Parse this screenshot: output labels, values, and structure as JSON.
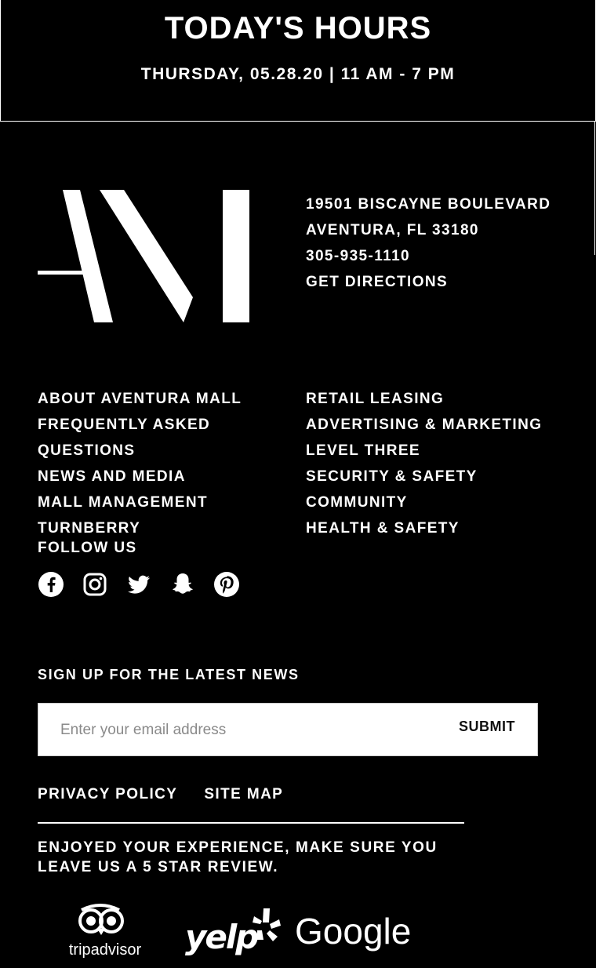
{
  "hours": {
    "title": "TODAY'S HOURS",
    "line": "THURSDAY, 05.28.20 | 11 AM - 7 PM"
  },
  "address": {
    "street": "19501 BISCAYNE BOULEVARD",
    "city": "AVENTURA, FL 33180",
    "phone": "305-935-1110",
    "directions": "GET DIRECTIONS"
  },
  "links_left": [
    "ABOUT AVENTURA MALL",
    "FREQUENTLY ASKED",
    "QUESTIONS",
    "NEWS AND MEDIA",
    "MALL MANAGEMENT",
    "TURNBERRY"
  ],
  "links_right": [
    "RETAIL LEASING",
    "ADVERTISING & MARKETING",
    "LEVEL THREE",
    "SECURITY & SAFETY",
    "COMMUNITY",
    "HEALTH & SAFETY"
  ],
  "follow": {
    "label": "FOLLOW US",
    "icons": [
      "facebook-icon",
      "instagram-icon",
      "twitter-icon",
      "snapchat-icon",
      "pinterest-icon"
    ]
  },
  "newsletter": {
    "label": "SIGN UP FOR THE LATEST NEWS",
    "placeholder": "Enter your email address",
    "submit": "SUBMIT"
  },
  "legal": {
    "privacy": "PRIVACY POLICY",
    "sitemap": "SITE MAP"
  },
  "review": {
    "text": "ENJOYED YOUR EXPERIENCE, MAKE SURE YOU LEAVE US A 5 STAR REVIEW.",
    "tripadvisor": "tripadvisor",
    "yelp": "yelp",
    "google": "Google"
  }
}
